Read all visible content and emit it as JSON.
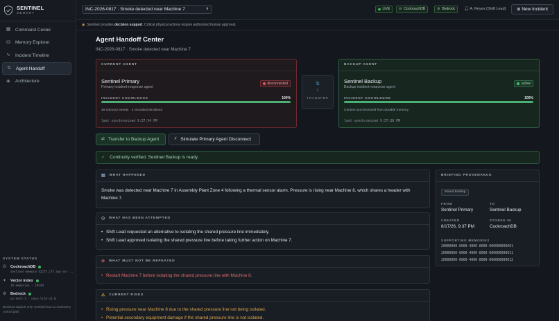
{
  "brand": {
    "name": "SENTINEL",
    "sub": "MEMORY"
  },
  "nav": [
    {
      "label": "Command Center",
      "icon": "grid-icon"
    },
    {
      "label": "Memory Explorer",
      "icon": "database-icon"
    },
    {
      "label": "Incident Timeline",
      "icon": "activity-icon"
    },
    {
      "label": "Agent Handoff",
      "icon": "handoff-icon",
      "active": true
    },
    {
      "label": "Architecture",
      "icon": "layers-icon"
    }
  ],
  "system_status": {
    "title": "SYSTEM STATUS",
    "items": [
      {
        "name": "CockroachDB",
        "detail": "sentinel-memory-32275.j77.aws-us-..."
      },
      {
        "name": "Vector index",
        "detail": "18 memories · 1024d"
      },
      {
        "name": "Bedrock",
        "detail": "us-east-1 · nova-lite-v1:0"
      }
    ],
    "note": "Decision support only. Sentinel has no machinery control path."
  },
  "topbar": {
    "incident": "INC-2026-0817 · Smoke detected near Machine 7",
    "pills": [
      "LIVE",
      "CockroachDB",
      "Bedrock"
    ],
    "user": "A. Reyes (Shift Lead)",
    "new_incident": "New Incident"
  },
  "banner": {
    "pre": "Sentinel provides ",
    "bold": "decision support",
    "post": ". Critical physical actions require authorized human approval."
  },
  "page": {
    "title": "Agent Handoff Center",
    "subtitle": "INC-2026-0817 · Smoke detected near Machine 7"
  },
  "current_agent": {
    "head": "CURRENT AGENT",
    "name": "Sentinel Primary",
    "role": "Primary incident-response agent",
    "status": "disconnected",
    "knowledge_label": "INCIDENT KNOWLEDGE",
    "knowledge": "100%",
    "knowledge_fraction": 1.0,
    "note": "29 memory events · 2 recorded decisions",
    "synced": "last synchronized 9:37:54 PM"
  },
  "transfer_label": "TRANSFER",
  "backup_agent": {
    "head": "BACKUP AGENT",
    "name": "Sentinel Backup",
    "role": "Backup incident-response agent",
    "status": "active",
    "knowledge_label": "INCIDENT KNOWLEDGE",
    "knowledge": "100%",
    "knowledge_fraction": 1.0,
    "note": "Context synchronized from durable memory",
    "synced": "last synchronized 9:37:38 PM"
  },
  "actions": {
    "transfer": "Transfer to Backup Agent",
    "simulate": "Simulate Primary Agent Disconnect"
  },
  "continuity": "Continuity verified. Sentinel Backup is ready.",
  "sections": {
    "happened": {
      "title": "WHAT HAPPENED",
      "text": "Smoke was detected near Machine 7 in Assembly Plant Zone 4 following a thermal sensor alarm. Pressure is rising near Machine 8, which shares a header with Machine 7."
    },
    "attempted": {
      "title": "WHAT HAS BEEN ATTEMPTED",
      "items": [
        "Shift Lead requested an alternative to isolating the shared pressure line immediately.",
        "Shift Lead approved isolating the shared pressure line before taking further action on Machine 7."
      ]
    },
    "not_repeated": {
      "title": "WHAT MUST NOT BE REPEATED",
      "items": [
        "Restart Machine 7 before isolating the shared pressure line with Machine 8."
      ]
    },
    "risks": {
      "title": "CURRENT RISKS",
      "items": [
        "Rising pressure near Machine 8 due to the shared pressure line not being isolated.",
        "Potential secondary equipment damage if the shared pressure line is not isolated."
      ]
    }
  },
  "provenance": {
    "title": "BRIEFING PROVENANCE",
    "tag": "stored briefing",
    "from_label": "FROM",
    "from": "Sentinel Primary",
    "to_label": "TO",
    "to": "Sentinel Backup",
    "created_label": "CREATED",
    "created": "8/17/26, 9:37 PM",
    "stored_label": "STORED IN",
    "stored": "CockroachDB",
    "memories_label": "SUPPORTING MEMORIES",
    "memories": [
      "20000000-0000-4000-8000-000000000001",
      "20000000-0000-4000-8000-000000000011",
      "20000000-0000-4000-8000-000000000012"
    ]
  },
  "colors": {
    "accent_green": "#4caf74",
    "danger": "#e05a5f",
    "warning": "#e0a34a"
  }
}
